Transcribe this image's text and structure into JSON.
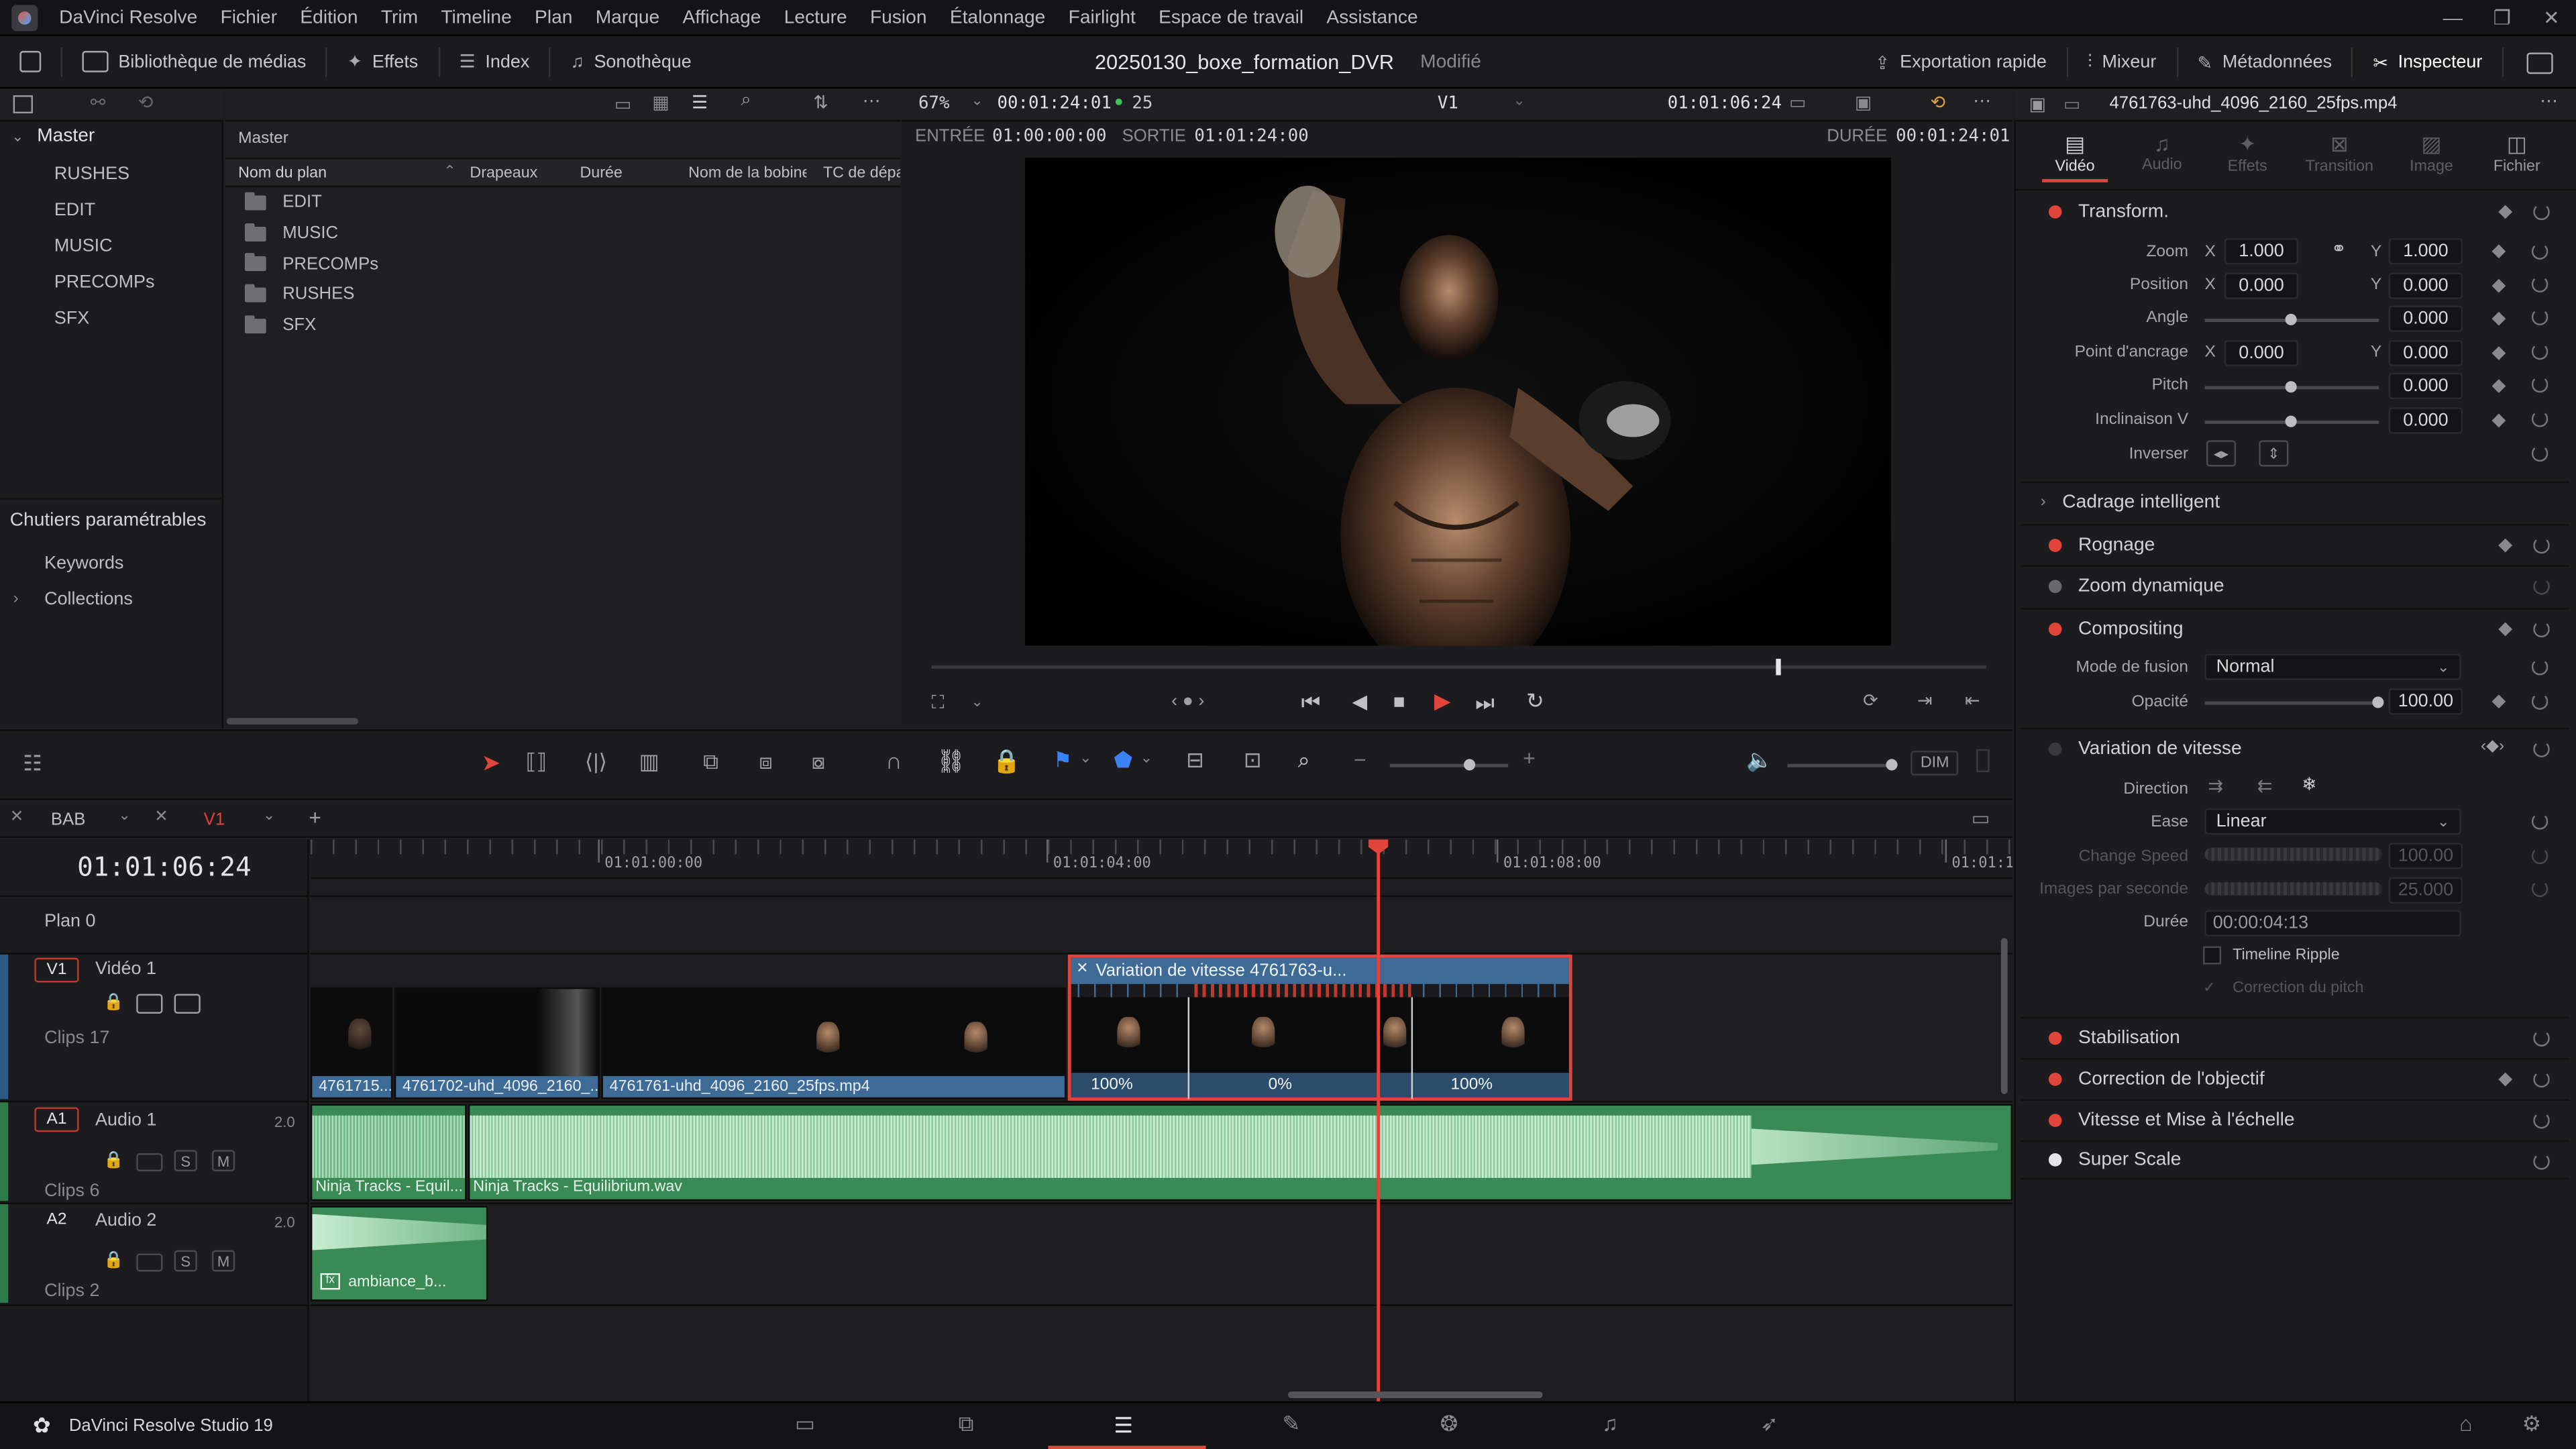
{
  "app_menu": [
    "DaVinci Resolve",
    "Fichier",
    "Édition",
    "Trim",
    "Timeline",
    "Plan",
    "Marque",
    "Affichage",
    "Lecture",
    "Fusion",
    "Étalonnage",
    "Fairlight",
    "Espace de travail",
    "Assistance"
  ],
  "toolbar": {
    "media_library": "Bibliothèque de médias",
    "effects": "Effets",
    "index": "Index",
    "sound_library": "Sonothèque",
    "project_name": "20250130_boxe_formation_DVR",
    "project_status": "Modifié",
    "quick_export": "Exportation rapide",
    "mixer": "Mixeur",
    "metadata": "Métadonnées",
    "inspector": "Inspecteur"
  },
  "bins": {
    "master": "Master",
    "items": [
      "RUSHES",
      "EDIT",
      "MUSIC",
      "PRECOMPs",
      "SFX"
    ],
    "smart_bins": "Chutiers paramétrables",
    "keywords": "Keywords",
    "collections": "Collections"
  },
  "media_pool": {
    "title": "Master",
    "columns": [
      "Nom du plan",
      "Drapeaux",
      "Durée",
      "Nom de la bobine",
      "TC de dépa"
    ],
    "folders": [
      "EDIT",
      "MUSIC",
      "PRECOMPs",
      "RUSHES",
      "SFX"
    ]
  },
  "viewer": {
    "zoom": "67%",
    "timecode": "00:01:24:01",
    "fps": "25",
    "track": "V1",
    "current_tc": "01:01:06:24",
    "in_label": "ENTRÉE",
    "in_tc": "01:00:00:00",
    "out_label": "SORTIE",
    "out_tc": "01:01:24:00",
    "dur_label": "DURÉE",
    "dur_tc": "00:01:24:01",
    "playhead_fraction": 0.8
  },
  "inspector": {
    "clip_name": "4761763-uhd_4096_2160_25fps.mp4",
    "tabs": [
      "Vidéo",
      "Audio",
      "Effets",
      "Transition",
      "Image",
      "Fichier"
    ],
    "transform": "Transform.",
    "zoom_label": "Zoom",
    "zoom_x": "1.000",
    "zoom_y": "1.000",
    "position_label": "Position",
    "pos_x": "0.000",
    "pos_y": "0.000",
    "angle_label": "Angle",
    "angle": "0.000",
    "anchor_label": "Point d'ancrage",
    "anchor_x": "0.000",
    "anchor_y": "0.000",
    "pitch_label": "Pitch",
    "pitch": "0.000",
    "yaw_label": "Inclinaison V",
    "yaw": "0.000",
    "flip_label": "Inverser",
    "x": "X",
    "y": "Y",
    "smart_reframe": "Cadrage intelligent",
    "cropping": "Rognage",
    "dynamic_zoom": "Zoom dynamique",
    "compositing": "Compositing",
    "blend_label": "Mode de fusion",
    "blend_value": "Normal",
    "opacity_label": "Opacité",
    "opacity": "100.00",
    "speed_ramp": "Variation de vitesse",
    "direction_label": "Direction",
    "ease_label": "Ease",
    "ease_value": "Linear",
    "change_speed_label": "Change Speed",
    "change_speed": "100.00",
    "fps_label": "Images par seconde",
    "fps_value": "25.000",
    "duration_label": "Durée",
    "duration": "00:00:04:13",
    "ripple_label": "Timeline Ripple",
    "pitch_corr_label": "Correction du pitch",
    "stabilization": "Stabilisation",
    "lens_correction": "Correction de l'objectif",
    "retime_scale": "Vitesse et Mise à l'échelle",
    "super_scale": "Super Scale",
    "colors": {
      "active": "#e0443a",
      "inactive": "#6a6a6e"
    }
  },
  "timeline": {
    "tab1": "BAB",
    "tab2": "V1",
    "timecode": "01:01:06:24",
    "ruler": [
      "01:01:00:00",
      "01:01:04:00",
      "01:01:08:00",
      "01:01:1"
    ],
    "plan": "Plan 0",
    "v1_tag": "V1",
    "v1_name": "Vidéo 1",
    "v1_clips": "Clips 17",
    "a1_tag": "A1",
    "a1_name": "Audio 1",
    "a1_level": "2.0",
    "a1_clips": "Clips 6",
    "a2_tag": "A2",
    "a2_name": "Audio 2",
    "a2_level": "2.0",
    "a2_clips": "Clips 2",
    "s": "S",
    "m": "M",
    "video_clips": [
      "4761715...",
      "4761702-uhd_4096_2160_...",
      "4761761-uhd_4096_2160_25fps.mp4"
    ],
    "speed_clip_title": "Variation de vitesse   4761763-u...",
    "speed_segments": [
      "100%",
      "0%",
      "100%"
    ],
    "audio_clips": [
      "Ninja Tracks - Equil...",
      "Ninja Tracks - Equilibrium.wav"
    ],
    "a2_clip": "ambiance_b...",
    "dim": "DIM"
  },
  "footer": {
    "app_name": "DaVinci Resolve Studio 19"
  }
}
